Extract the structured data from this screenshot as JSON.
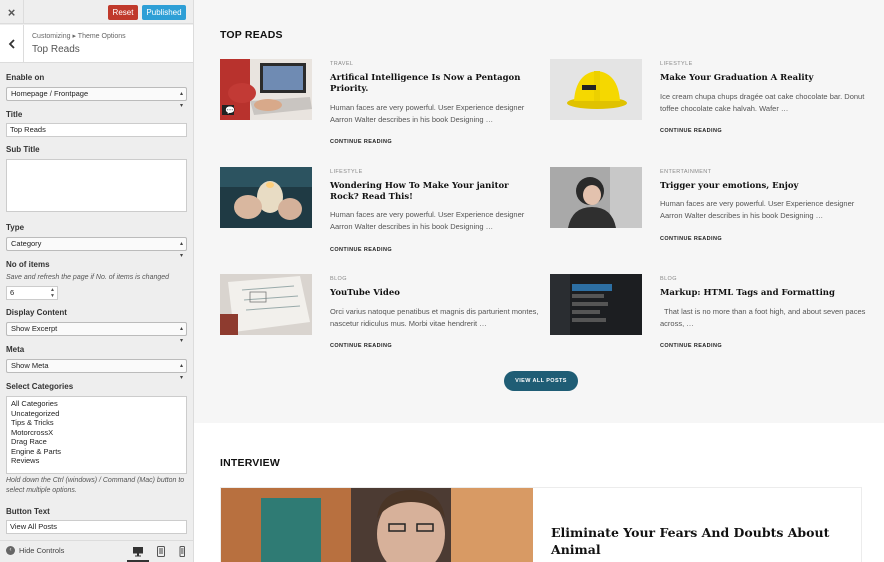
{
  "sidebar": {
    "close_label": "×",
    "reset_label": "Reset",
    "published_label": "Published",
    "breadcrumb": "Customizing ▸ Theme Options",
    "panel_title": "Top Reads",
    "fields": {
      "enable_on": {
        "label": "Enable on",
        "value": "Homepage / Frontpage"
      },
      "title": {
        "label": "Title",
        "value": "Top Reads"
      },
      "sub_title": {
        "label": "Sub Title",
        "value": ""
      },
      "type": {
        "label": "Type",
        "value": "Category"
      },
      "no_of_items": {
        "label": "No of items",
        "hint": "Save and refresh the page if No. of items is changed",
        "value": "6"
      },
      "display_content": {
        "label": "Display Content",
        "value": "Show Excerpt"
      },
      "meta": {
        "label": "Meta",
        "value": "Show Meta"
      },
      "select_categories": {
        "label": "Select Categories",
        "options": [
          "All Categories",
          "Uncategorized",
          "Tips & Tricks",
          "MotorcrossX",
          "Drag Race",
          "Engine & Parts",
          "Reviews"
        ],
        "hint": "Hold down the Ctrl (windows) / Command (Mac) button to select multiple options."
      },
      "button_text": {
        "label": "Button Text",
        "value": "View All Posts"
      }
    },
    "footer": {
      "hide_controls": "Hide Controls"
    }
  },
  "main": {
    "top_reads": {
      "title": "TOP READS",
      "posts": [
        {
          "category": "TRAVEL",
          "title": "Artifical Intelligence Is Now a Pentagon Priority.",
          "excerpt": "Human faces are very powerful. User Experience designer Aarron Walter describes in his book Designing …",
          "more": "CONTINUE READING"
        },
        {
          "category": "LIFESTYLE",
          "title": "Make Your Graduation A Reality",
          "excerpt": "Ice cream chupa chups dragée oat cake chocolate bar. Donut toffee chocolate cake halvah. Wafer …",
          "more": "CONTINUE READING"
        },
        {
          "category": "LIFESTYLE",
          "title": "Wondering How To Make Your janitor Rock? Read This!",
          "excerpt": "Human faces are very powerful. User Experience designer Aarron Walter describes in his book Designing …",
          "more": "CONTINUE READING"
        },
        {
          "category": "ENTERTAINMENT",
          "title": "Trigger your emotions, Enjoy",
          "excerpt": "Human faces are very powerful. User Experience designer Aarron Walter describes in his book Designing …",
          "more": "CONTINUE READING"
        },
        {
          "category": "BLOG",
          "title": "YouTube Video",
          "excerpt": "Orci varius natoque penatibus et magnis dis parturient montes, nascetur ridiculus mus. Morbi vitae hendrerit …",
          "more": "CONTINUE READING"
        },
        {
          "category": "BLOG",
          "title": "Markup: HTML Tags and Formatting",
          "excerpt": "That last is no more than a foot high, and about seven paces across, …",
          "more": "CONTINUE READING"
        }
      ],
      "view_all": "VIEW ALL POSTS"
    },
    "interview": {
      "title": "INTERVIEW",
      "post_title": "Eliminate Your Fears And Doubts About Animal"
    }
  },
  "colors": {
    "reset": "#c0392b",
    "published": "#2e9fd6",
    "view_all": "#1f5d75"
  }
}
